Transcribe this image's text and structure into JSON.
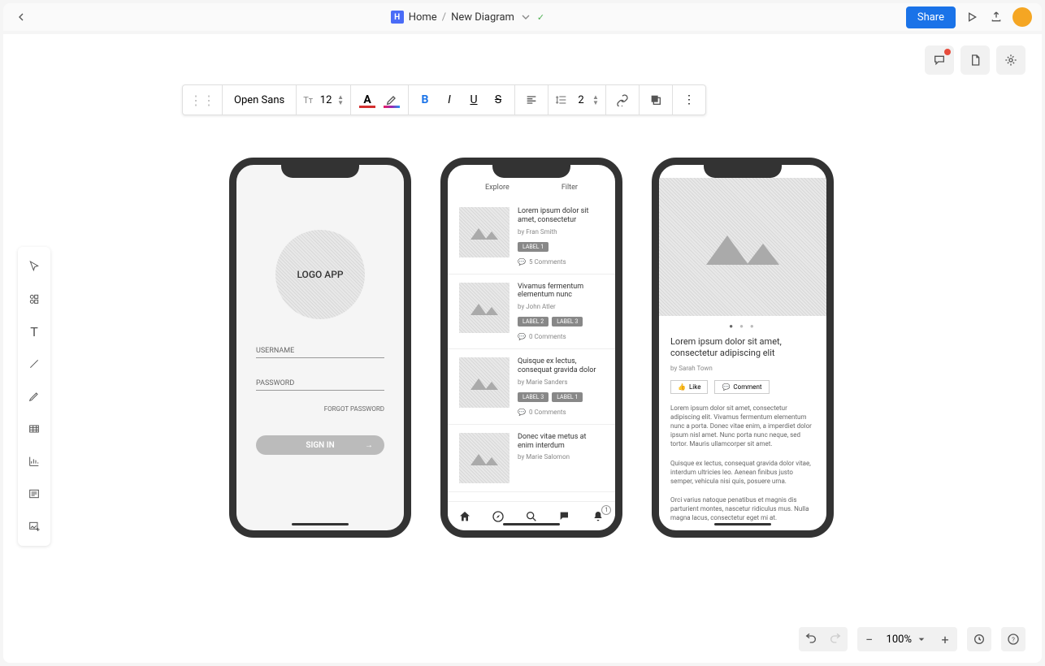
{
  "topbar": {
    "home": "Home",
    "diagram_name": "New Diagram",
    "share": "Share"
  },
  "toolbar": {
    "font": "Open Sans",
    "font_size": "12",
    "line_height": "2"
  },
  "phones": {
    "login": {
      "logo": "LOGO APP",
      "username": "USERNAME",
      "password": "PASSWORD",
      "forgot": "FORGOT PASSWORD",
      "signin": "SIGN IN"
    },
    "feed": {
      "explore": "Explore",
      "filter": "Filter",
      "items": [
        {
          "title": "Lorem ipsum dolor sit amet, consectetur",
          "author": "by Fran Smith",
          "labels": [
            "LABEL 1"
          ],
          "comments": "5 Comments"
        },
        {
          "title": "Vivamus fermentum elementum nunc",
          "author": "by John Atler",
          "labels": [
            "LABEL 2",
            "LABEL 3"
          ],
          "comments": "0 Comments"
        },
        {
          "title": "Quisque ex lectus, consequat gravida dolor",
          "author": "by Marie Sanders",
          "labels": [
            "LABEL 3",
            "LABEL 1"
          ],
          "comments": "0 Comments"
        },
        {
          "title": "Donec vitae metus at enim interdum",
          "author": "by Marie Salomon",
          "labels": [],
          "comments": ""
        }
      ],
      "nav_badge": "1"
    },
    "detail": {
      "title": "Lorem ipsum dolor sit amet, consectetur adipiscing elit",
      "author": "by Sarah Town",
      "like": "Like",
      "comment": "Comment",
      "p1": "Lorem ipsum dolor sit amet, consectetur adipiscing elit. Vivamus fermentum elementum nunc a porta. Donec vitae enim, a imperdiet dolor ipsum nisl amet. Nunc porta nunc neque, sed tortor. Mauris ullamcorper sit amet.",
      "p2": "Quisque ex lectus, consequat gravida dolor vitae, interdum ultricies leo. Aenean finibus justo semper, vehicula nisi quis, posuere urna.",
      "p3": "Orci varius natoque penatibus et magnis dis parturient montes, nascetur ridiculus mus. Nulla magna lacus, consectetur eget mi at."
    }
  },
  "bottom": {
    "zoom": "100%"
  }
}
